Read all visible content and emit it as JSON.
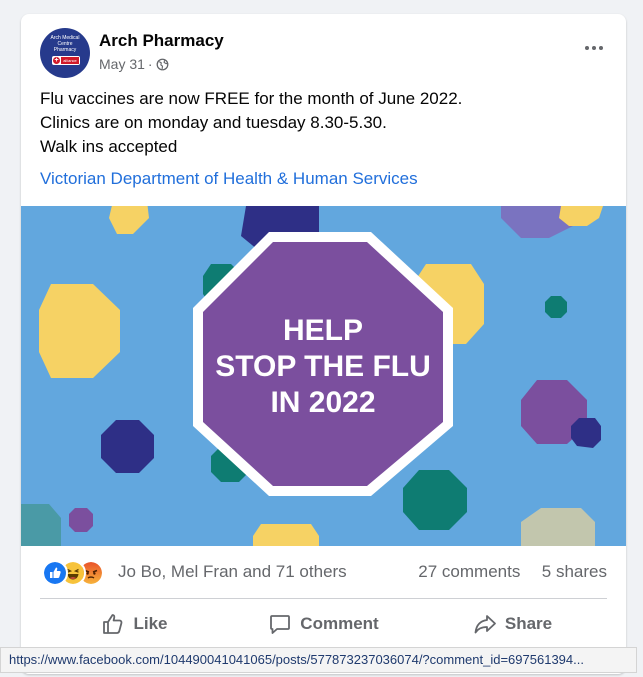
{
  "post": {
    "page_name": "Arch Pharmacy",
    "date": "May 31",
    "separator": "·",
    "avatar_text_lines": [
      "Arch Medical",
      "Centre",
      "Pharmacy"
    ],
    "avatar_badge_text": "alliance",
    "text_lines": [
      "Flu vaccines are now FREE for the month of June 2022.",
      "Clinics are on monday and tuesday 8.30-5.30.",
      "Walk ins accepted"
    ],
    "link_text": "Victorian Department of Health & Human Services"
  },
  "media": {
    "headline_lines": [
      "HELP",
      "STOP THE FLU",
      "IN 2022"
    ],
    "colors": {
      "background": "#62a7de",
      "purple": "#7b4f9e",
      "navy": "#2e2f86",
      "teal": "#0e7c72",
      "yellow": "#f6d264",
      "lavender": "#7a73c0",
      "sage": "#c2c6ad"
    }
  },
  "reactions": {
    "icons": [
      "like-icon",
      "haha-icon",
      "angry-icon"
    ],
    "names": "Jo Bo, Mel Fran and 71 others",
    "comments": "27 comments",
    "shares": "5 shares"
  },
  "actions": {
    "like": "Like",
    "comment": "Comment",
    "share": "Share"
  },
  "status_bar": {
    "url": "https://www.facebook.com/104490041041065/posts/577873237036074/?comment_id=697561394..."
  }
}
